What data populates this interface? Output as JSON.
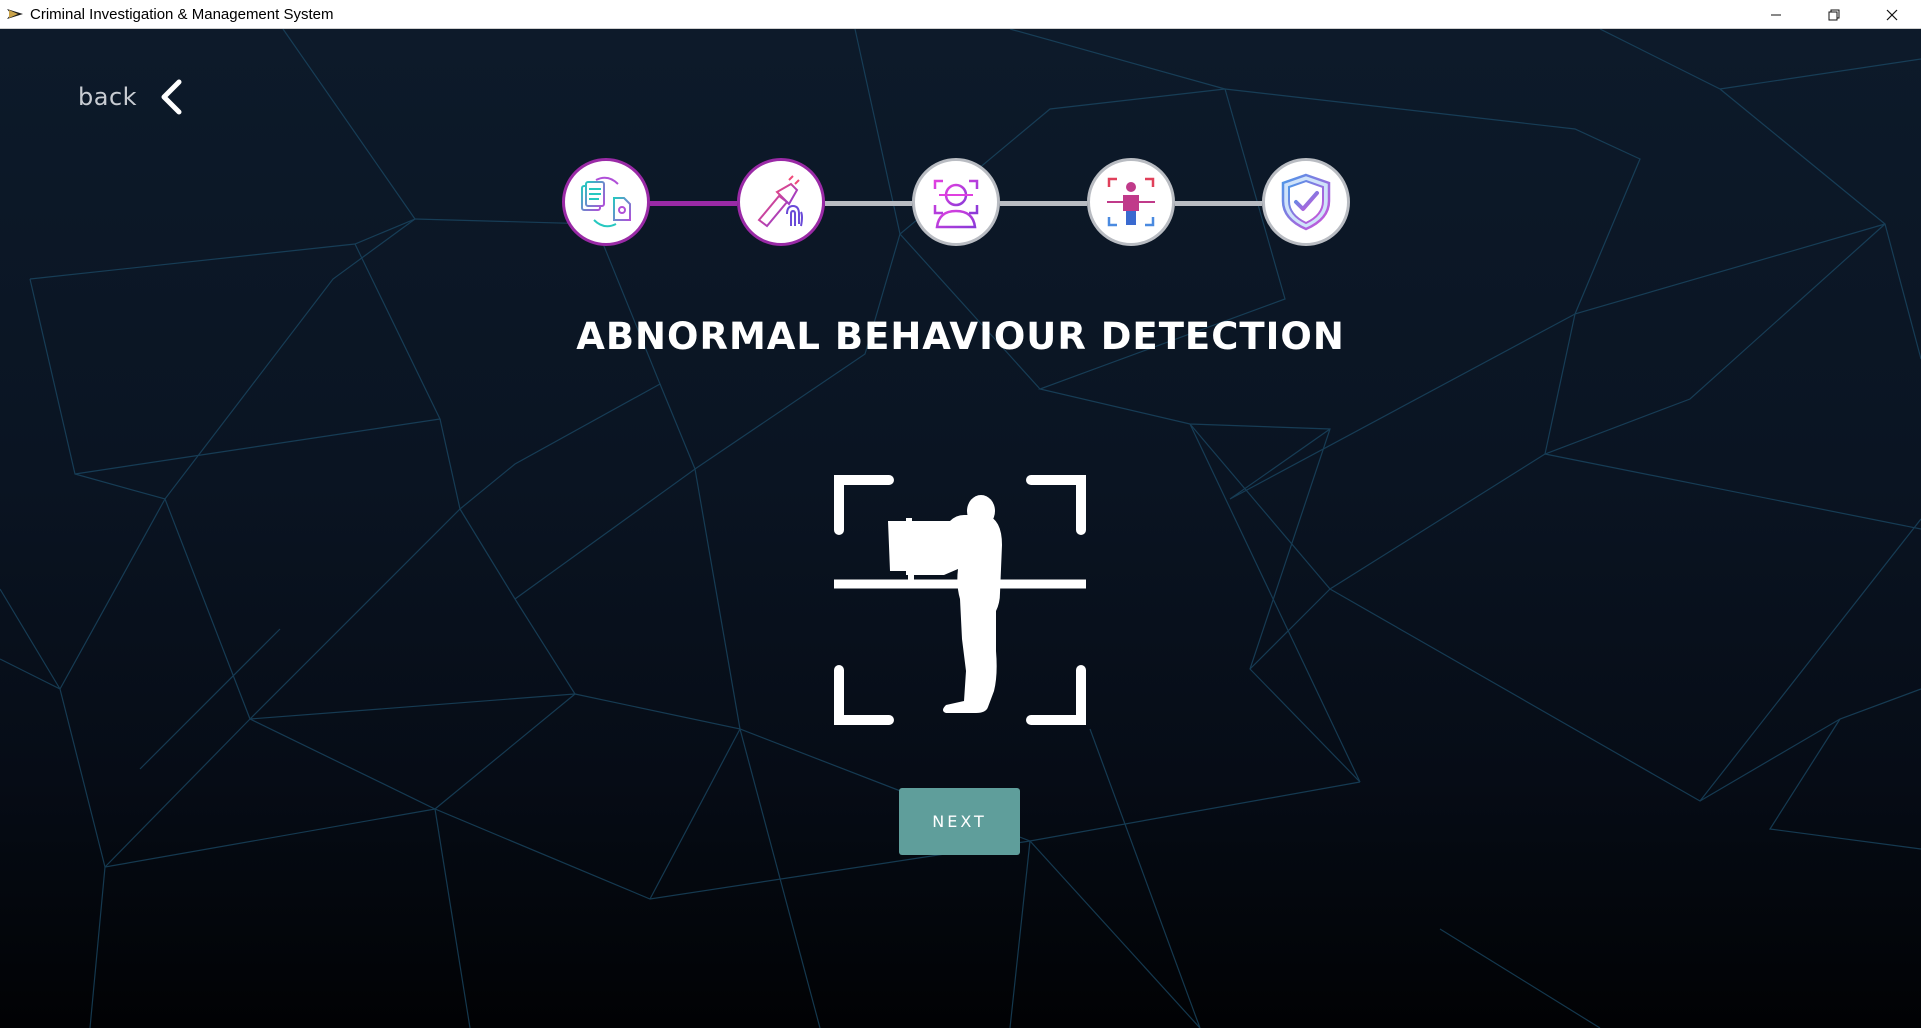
{
  "window": {
    "title": "Criminal Investigation & Management System",
    "controls": [
      "minimize-icon",
      "restore-icon",
      "close-icon"
    ]
  },
  "nav": {
    "back_label": "back"
  },
  "stepper": {
    "steps": [
      {
        "icon": "document-processing-icon",
        "state": "completed"
      },
      {
        "icon": "fingerprint-evidence-icon",
        "state": "current"
      },
      {
        "icon": "face-recognition-icon",
        "state": "pending"
      },
      {
        "icon": "body-scan-icon",
        "state": "pending"
      },
      {
        "icon": "shield-check-icon",
        "state": "pending"
      }
    ],
    "active_color": "#9a2aa6",
    "inactive_color": "#b9bcc2"
  },
  "main": {
    "title": "ABNORMAL BEHAVIOUR DETECTION",
    "illustration": "armed-person-scan-icon",
    "next_label": "NEXT"
  },
  "colors": {
    "background": "#0a1422",
    "mesh_lines": "#1b4a66",
    "button": "#5f9e9b"
  }
}
